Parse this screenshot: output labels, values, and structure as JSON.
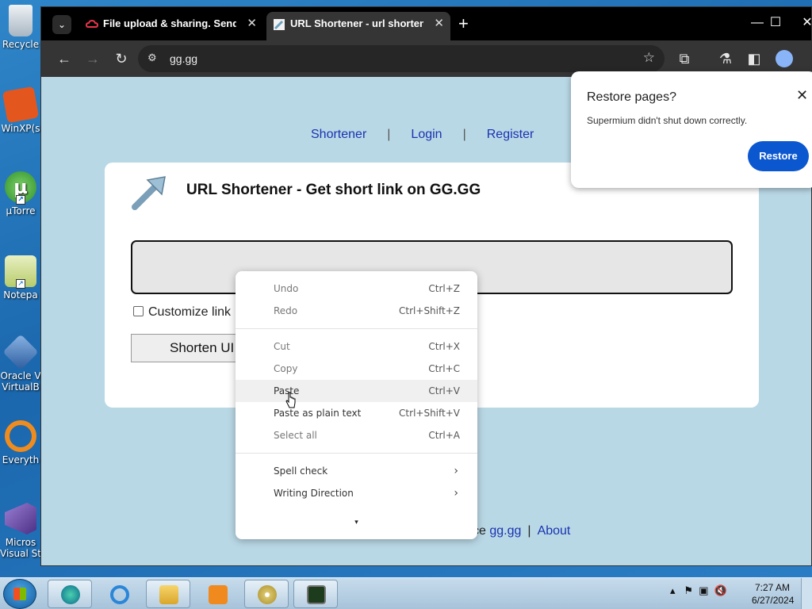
{
  "desktop": {
    "icons": [
      {
        "label": "Recycle",
        "icon": "recycle-bin-icon",
        "color": "#c9d3dc"
      },
      {
        "label": "WinXP(s",
        "icon": "winxp-vdi-icon",
        "color": "#e3571f"
      },
      {
        "label": "µTorre",
        "icon": "utorrent-icon",
        "color": "#4caf50"
      },
      {
        "label": "Notepa",
        "icon": "notepad-icon",
        "color": "#dbe6a7"
      },
      {
        "label": "Oracle V VirtualB",
        "icon": "virtualbox-icon",
        "color": "#3c6fb1"
      },
      {
        "label": "Everyth",
        "icon": "everything-search-icon",
        "color": "#f08c1d"
      },
      {
        "label": "Micros Visual St",
        "icon": "visual-studio-icon",
        "color": "#6b4fa5"
      }
    ]
  },
  "browser": {
    "tabs": [
      {
        "title": "File upload & sharing. Send la",
        "favicon": "cloud-upload-icon",
        "active": false
      },
      {
        "title": "URL Shortener - url shortening",
        "favicon": "gg-favicon-icon",
        "active": true
      }
    ],
    "new_tab_label": "+",
    "window_controls": {
      "minimize": "—",
      "maximize": "☐",
      "close": "✕"
    },
    "address": "gg.gg",
    "accent": "#0b57d0"
  },
  "page": {
    "nav": [
      "Shortener",
      "Login",
      "Register"
    ],
    "nav_separator": "|",
    "heading": "URL Shortener - Get short link on GG.GG",
    "input_value": "",
    "customize_label": "Customize link",
    "shorten_button": "Shorten UI",
    "footer": {
      "prefix": "ce",
      "link1": "gg.gg",
      "separator": "|",
      "link2": "About"
    }
  },
  "restore_popup": {
    "title": "Restore pages?",
    "message": "Supermium didn't shut down correctly.",
    "button": "Restore",
    "close": "✕"
  },
  "context_menu": {
    "group1": [
      {
        "label": "Undo",
        "shortcut": "Ctrl+Z"
      },
      {
        "label": "Redo",
        "shortcut": "Ctrl+Shift+Z"
      }
    ],
    "group2": [
      {
        "label": "Cut",
        "shortcut": "Ctrl+X"
      },
      {
        "label": "Copy",
        "shortcut": "Ctrl+C"
      },
      {
        "label": "Paste",
        "shortcut": "Ctrl+V"
      },
      {
        "label": "Paste as plain text",
        "shortcut": "Ctrl+Shift+V"
      },
      {
        "label": "Select all",
        "shortcut": "Ctrl+A"
      }
    ],
    "group3": [
      {
        "label": "Spell check",
        "submenu": "›"
      },
      {
        "label": "Writing Direction",
        "submenu": "›"
      }
    ],
    "more": "▾"
  },
  "taskbar": {
    "apps": [
      "edge-legacy-icon",
      "internet-explorer-icon",
      "file-explorer-icon",
      "media-player-icon",
      "dvd-maker-icon",
      "cmd-monitor-icon"
    ],
    "time": "7:27 AM",
    "date": "6/27/2024"
  }
}
